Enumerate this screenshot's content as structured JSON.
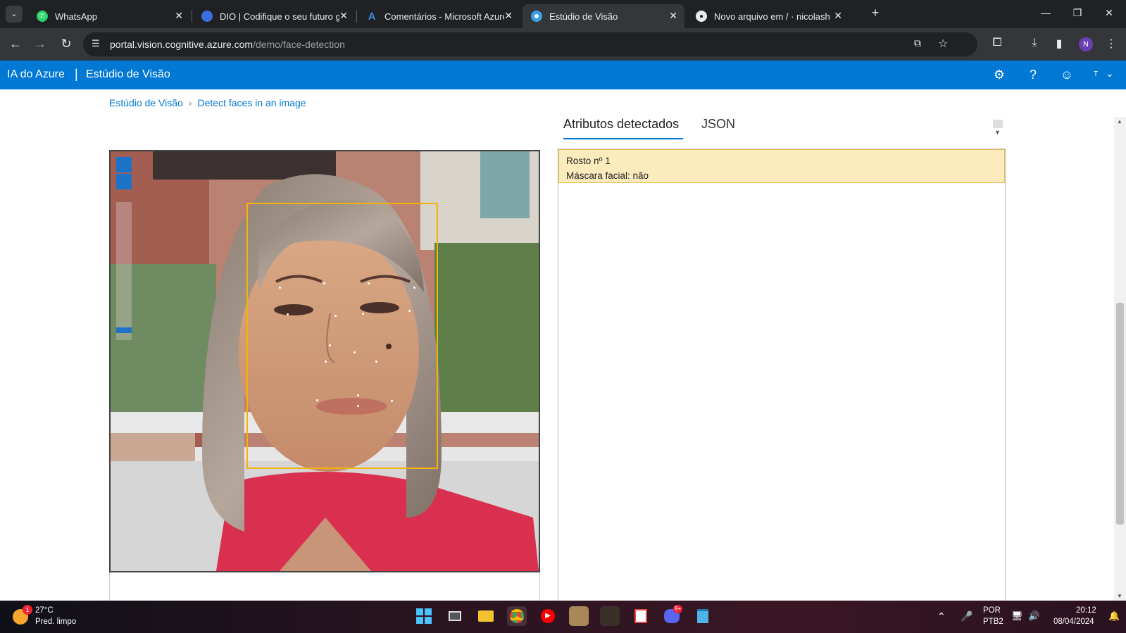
{
  "browser": {
    "tabs": [
      {
        "title": "WhatsApp",
        "icon": "whatsapp-icon"
      },
      {
        "title": "DIO | Codifique o seu futuro gl",
        "icon": "dio-icon"
      },
      {
        "title": "Comentários - Microsoft Azure",
        "icon": "azure-icon"
      },
      {
        "title": "Estúdio de Visão",
        "icon": "vision-studio-icon",
        "active": true
      },
      {
        "title": "Novo arquivo em / · nicolashac",
        "icon": "github-icon"
      }
    ],
    "url_host": "portal.vision.cognitive.azure.com",
    "url_path": "/demo/face-detection",
    "profile_initial": "N"
  },
  "header": {
    "brand": "IA do Azure",
    "separator": "|",
    "studio": "Estúdio de Visão",
    "user_initial": "T"
  },
  "breadcrumb": {
    "root": "Estúdio de Visão",
    "current": "Detect faces in an image"
  },
  "result_tabs": {
    "attributes": "Atributos detectados",
    "json": "JSON"
  },
  "faces": [
    {
      "title": "Rosto nº 1",
      "mask": "Máscara facial: não"
    }
  ],
  "taskbar": {
    "weather_temp": "27°C",
    "weather_desc": "Pred. limpo",
    "weather_badge": "1",
    "discord_badge": "9+",
    "lang_top": "POR",
    "lang_bottom": "PTB2",
    "time": "20:12",
    "date": "08/04/2024"
  },
  "colors": {
    "azure_blue": "#0078d4",
    "face_box": "#f5b400",
    "card_bg": "#fcebbc"
  }
}
